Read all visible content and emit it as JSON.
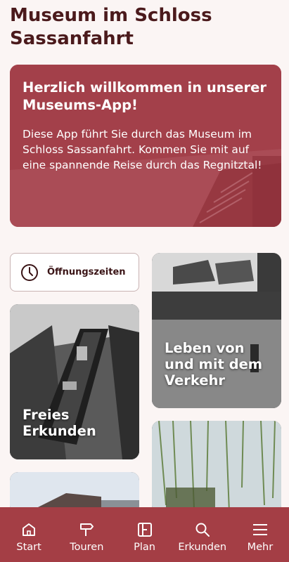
{
  "page": {
    "title": "Museum im Schloss Sassanfahrt"
  },
  "hero": {
    "title": "Herzlich willkommen in unserer Museums-App!",
    "text": "Diese App führt Sie durch das Museum im Schloss Sassanfahrt. Kommen Sie mit auf eine spannende Reise durch das Regnitztal!"
  },
  "hours_button": {
    "label": "Öffnungszeiten",
    "icon": "clock-icon"
  },
  "tiles": [
    {
      "label": "Freies Erkunden",
      "image": "barge-on-canal-photo"
    },
    {
      "label": "Leben von und mit dem Verkehr",
      "image": "canal-with-houses-photo"
    },
    {
      "label": "",
      "image": "house-sky-photo"
    },
    {
      "label": "",
      "image": "willow-trees-photo"
    }
  ],
  "bottom_nav": {
    "items": [
      {
        "label": "Start",
        "icon": "home-icon"
      },
      {
        "label": "Touren",
        "icon": "signpost-icon"
      },
      {
        "label": "Plan",
        "icon": "map-icon"
      },
      {
        "label": "Erkunden",
        "icon": "search-icon"
      },
      {
        "label": "Mehr",
        "icon": "menu-icon"
      }
    ]
  },
  "colors": {
    "brand": "#a43e45",
    "title": "#4b1a1c",
    "background": "#fbf5f4"
  }
}
